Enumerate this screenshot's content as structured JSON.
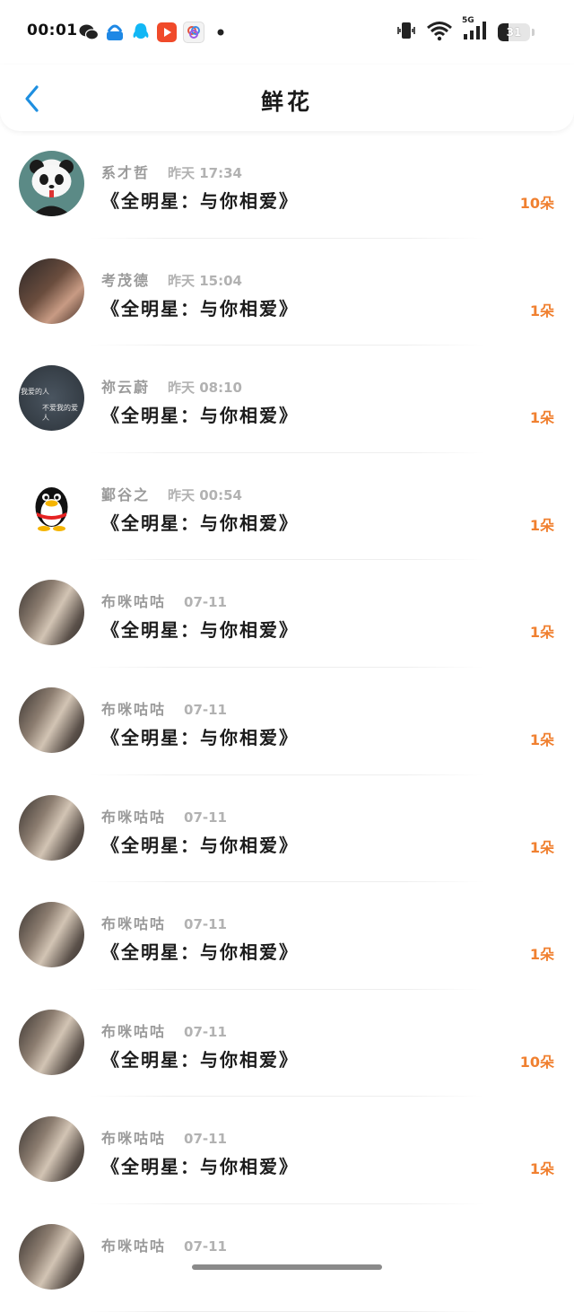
{
  "status_bar": {
    "time": "00:01",
    "notification_icons": [
      "wechat-icon",
      "app-store-icon",
      "qq-icon",
      "video-app-icon",
      "photo-app-icon",
      "dot-icon"
    ],
    "network": "5G",
    "battery_level": "31"
  },
  "nav": {
    "title": "鲜花"
  },
  "colors": {
    "accent": "#1e8fe0",
    "count": "#f08030"
  },
  "gifts": [
    {
      "name": "系才哲",
      "time": "昨天 17:34",
      "gift": "《全明星：与你相爱》",
      "count": "10朵",
      "avatar": "panda"
    },
    {
      "name": "考茂德",
      "time": "昨天 15:04",
      "gift": "《全明星：与你相爱》",
      "count": "1朵",
      "avatar": "girl"
    },
    {
      "name": "祢云蔚",
      "time": "昨天 08:10",
      "gift": "《全明星：与你相爱》",
      "count": "1朵",
      "avatar": "text",
      "avatar_text": [
        "我爱的人",
        "不爱我的爱人"
      ]
    },
    {
      "name": "鄞谷之",
      "time": "昨天 00:54",
      "gift": "《全明星：与你相爱》",
      "count": "1朵",
      "avatar": "qq"
    },
    {
      "name": "布咪咕咕",
      "time": "07-11",
      "gift": "《全明星：与你相爱》",
      "count": "1朵",
      "avatar": "photo"
    },
    {
      "name": "布咪咕咕",
      "time": "07-11",
      "gift": "《全明星：与你相爱》",
      "count": "1朵",
      "avatar": "photo"
    },
    {
      "name": "布咪咕咕",
      "time": "07-11",
      "gift": "《全明星：与你相爱》",
      "count": "1朵",
      "avatar": "photo"
    },
    {
      "name": "布咪咕咕",
      "time": "07-11",
      "gift": "《全明星：与你相爱》",
      "count": "1朵",
      "avatar": "photo"
    },
    {
      "name": "布咪咕咕",
      "time": "07-11",
      "gift": "《全明星：与你相爱》",
      "count": "10朵",
      "avatar": "photo"
    },
    {
      "name": "布咪咕咕",
      "time": "07-11",
      "gift": "《全明星：与你相爱》",
      "count": "1朵",
      "avatar": "photo"
    },
    {
      "name": "布咪咕咕",
      "time": "07-11",
      "gift": "",
      "count": "",
      "avatar": "photo"
    }
  ]
}
